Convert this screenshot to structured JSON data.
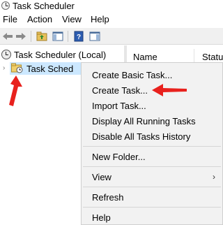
{
  "window": {
    "title": "Task Scheduler",
    "icon": "clock-icon"
  },
  "menubar": {
    "items": [
      {
        "label": "File"
      },
      {
        "label": "Action"
      },
      {
        "label": "View"
      },
      {
        "label": "Help"
      }
    ]
  },
  "toolbar": {
    "buttons": [
      {
        "icon": "back-arrow-icon"
      },
      {
        "icon": "forward-arrow-icon"
      },
      {
        "icon": "up-folder-icon"
      },
      {
        "icon": "show-hide-console-tree-icon"
      },
      {
        "icon": "help-icon"
      },
      {
        "icon": "action-pane-icon"
      }
    ]
  },
  "tree": {
    "root_label": "Task Scheduler (Local)",
    "child_label": "Task Sched"
  },
  "grid": {
    "columns": [
      {
        "label": "Name"
      },
      {
        "label": "Statu"
      }
    ]
  },
  "context_menu": {
    "items": [
      {
        "label": "Create Basic Task..."
      },
      {
        "label": "Create Task..."
      },
      {
        "label": "Import Task..."
      },
      {
        "label": "Display All Running Tasks"
      },
      {
        "label": "Disable All Tasks History"
      },
      {
        "label": "New Folder..."
      },
      {
        "label": "View"
      },
      {
        "label": "Refresh"
      },
      {
        "label": "Help"
      }
    ],
    "submenu_indicator": "›"
  },
  "colors": {
    "annotation_arrow": "#e8211d",
    "selection": "#cce8ff",
    "menu_background": "#f2f2f2"
  }
}
